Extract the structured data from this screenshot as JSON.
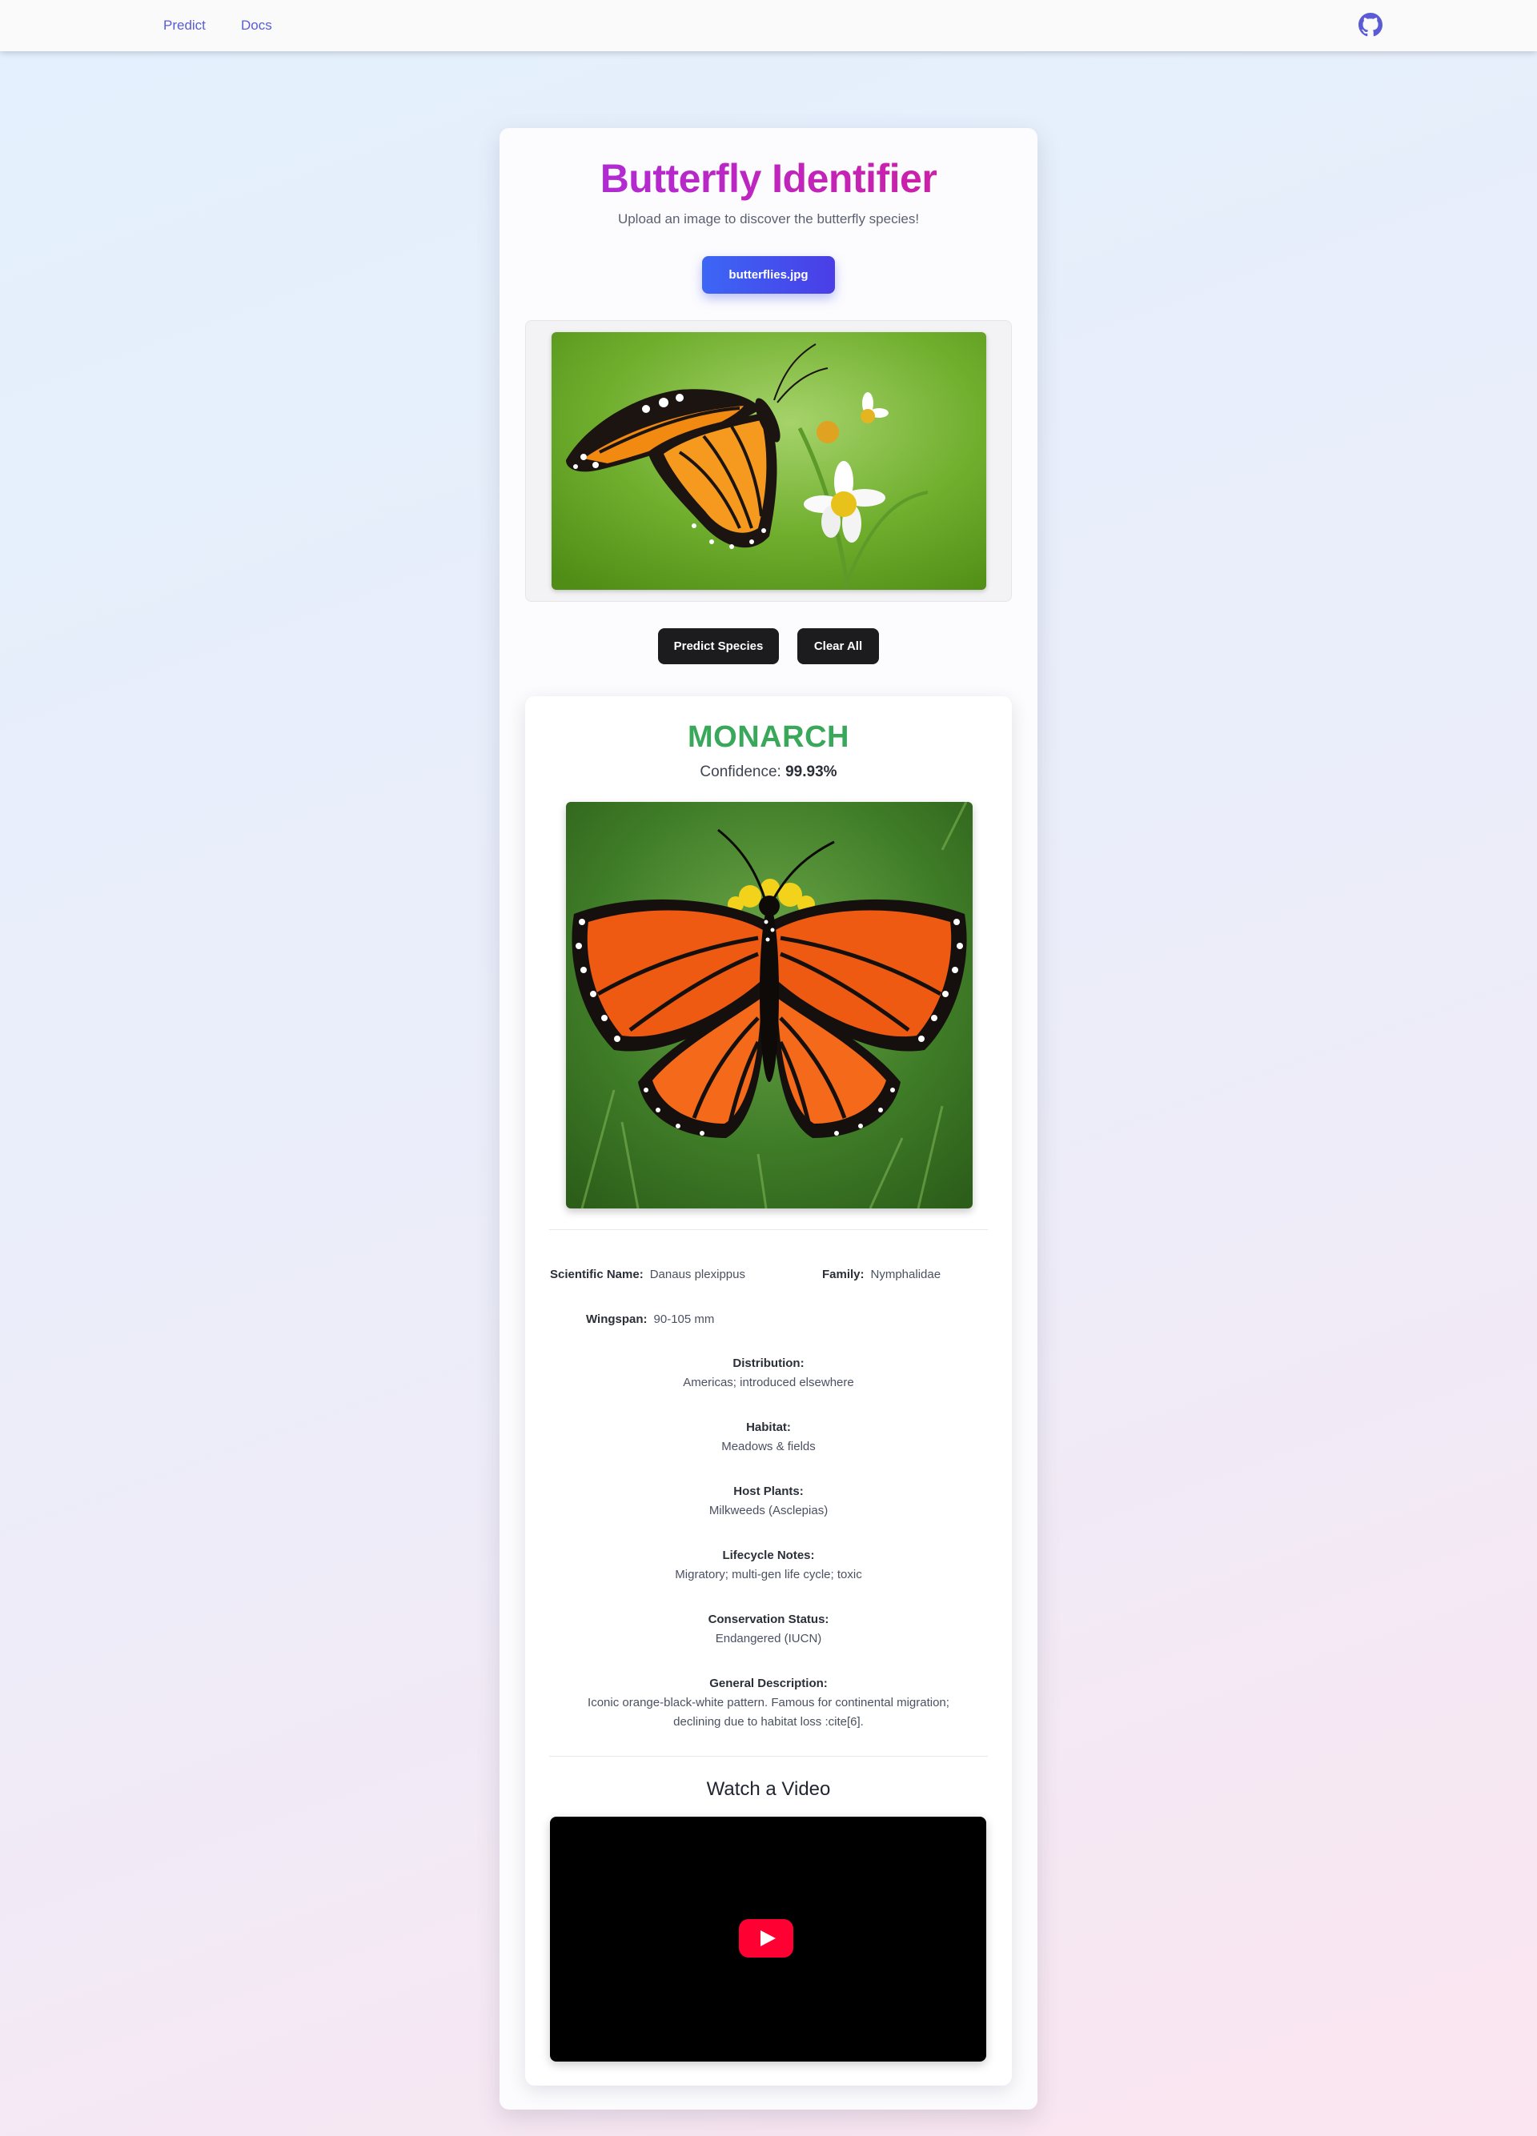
{
  "nav": {
    "links": [
      "Predict",
      "Docs"
    ]
  },
  "header": {
    "title": "Butterfly Identifier",
    "subtitle": "Upload an image to discover the butterfly species!"
  },
  "upload": {
    "file_name": "butterflies.jpg"
  },
  "actions": {
    "predict_label": "Predict Species",
    "clear_label": "Clear All"
  },
  "result": {
    "species": "MONARCH",
    "confidence_label": "Confidence:",
    "confidence_value": "99.93%",
    "fields": {
      "scientific_name": {
        "label": "Scientific Name:",
        "value": "Danaus plexippus"
      },
      "family": {
        "label": "Family:",
        "value": "Nymphalidae"
      },
      "wingspan": {
        "label": "Wingspan:",
        "value": "90-105 mm"
      },
      "distribution": {
        "label": "Distribution:",
        "value": "Americas; introduced elsewhere"
      },
      "habitat": {
        "label": "Habitat:",
        "value": "Meadows & fields"
      },
      "host_plants": {
        "label": "Host Plants:",
        "value": "Milkweeds (Asclepias)"
      },
      "lifecycle": {
        "label": "Lifecycle Notes:",
        "value": "Migratory; multi-gen life cycle; toxic"
      },
      "conservation": {
        "label": "Conservation Status:",
        "value": "Endangered (IUCN)"
      },
      "description": {
        "label": "General Description:",
        "line1": "Iconic orange-black-white pattern. Famous for continental migration;",
        "line2": "declining due to habitat loss :cite[6]."
      }
    },
    "video_title": "Watch a Video"
  },
  "colors": {
    "title_gradient": [
      "#a82ee0",
      "#d41d9b"
    ],
    "species": "#3aa85a",
    "upload_button": [
      "#3c66f5",
      "#4a3ee6"
    ],
    "nav_link": "#5b5bd6",
    "play_button": "#ff0033"
  },
  "icons": [
    "github-icon",
    "play-icon"
  ]
}
